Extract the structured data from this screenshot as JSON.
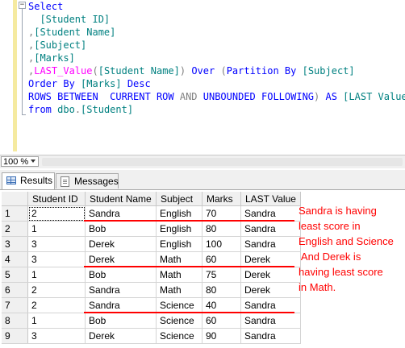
{
  "editor": {
    "collapse_glyph": "−",
    "lines": [
      [
        [
          "kw",
          "Select"
        ]
      ],
      [
        [
          "id",
          "  [Student ID]"
        ]
      ],
      [
        [
          "gr",
          ","
        ],
        [
          "id",
          "[Student Name]"
        ]
      ],
      [
        [
          "gr",
          ","
        ],
        [
          "id",
          "[Subject]"
        ]
      ],
      [
        [
          "gr",
          ","
        ],
        [
          "id",
          "[Marks]"
        ]
      ],
      [
        [
          "gr",
          ","
        ],
        [
          "fn",
          "LAST_Value"
        ],
        [
          "gr",
          "("
        ],
        [
          "id",
          "[Student Name]"
        ],
        [
          "gr",
          ") "
        ],
        [
          "kw",
          "Over "
        ],
        [
          "gr",
          "("
        ],
        [
          "kw",
          "Partition By "
        ],
        [
          "id",
          "[Subject]"
        ]
      ],
      [
        [
          "kw",
          "Order By "
        ],
        [
          "id",
          "[Marks] "
        ],
        [
          "kw",
          "Desc"
        ]
      ],
      [
        [
          "kw",
          "ROWS BETWEEN  CURRENT ROW "
        ],
        [
          "gr",
          "AND "
        ],
        [
          "kw",
          "UNBOUNDED FOLLOWING"
        ],
        [
          "gr",
          ") "
        ],
        [
          "kw",
          "AS "
        ],
        [
          "id",
          "[LAST Value]"
        ]
      ],
      [
        [
          "kw",
          "from "
        ],
        [
          "id",
          "dbo"
        ],
        [
          "gr",
          "."
        ],
        [
          "id",
          "[Student]"
        ]
      ]
    ]
  },
  "zoom": {
    "value": "100 %"
  },
  "tabs": [
    {
      "label": "Results",
      "icon": "grid-icon",
      "active": true
    },
    {
      "label": "Messages",
      "icon": "messages-icon",
      "active": false
    }
  ],
  "grid": {
    "columns": [
      "Student ID",
      "Student Name",
      "Subject",
      "Marks",
      "LAST Value"
    ],
    "rows": [
      {
        "n": "1",
        "cells": [
          "2",
          "Sandra",
          "English",
          "70",
          "Sandra"
        ]
      },
      {
        "n": "2",
        "cells": [
          "1",
          "Bob",
          "English",
          "80",
          "Sandra"
        ]
      },
      {
        "n": "3",
        "cells": [
          "3",
          "Derek",
          "English",
          "100",
          "Sandra"
        ]
      },
      {
        "n": "4",
        "cells": [
          "3",
          "Derek",
          "Math",
          "60",
          "Derek"
        ]
      },
      {
        "n": "5",
        "cells": [
          "1",
          "Bob",
          "Math",
          "75",
          "Derek"
        ]
      },
      {
        "n": "6",
        "cells": [
          "2",
          "Sandra",
          "Math",
          "80",
          "Derek"
        ]
      },
      {
        "n": "7",
        "cells": [
          "2",
          "Sandra",
          "Science",
          "40",
          "Sandra"
        ]
      },
      {
        "n": "8",
        "cells": [
          "1",
          "Bob",
          "Science",
          "60",
          "Sandra"
        ]
      },
      {
        "n": "9",
        "cells": [
          "3",
          "Derek",
          "Science",
          "90",
          "Sandra"
        ]
      }
    ]
  },
  "annotation": {
    "text": "Sandra is having\nleast score in\nEnglish and Science\n And Derek is\nhaving least score\nin Math.",
    "underlined_rows": [
      1,
      4,
      7
    ],
    "color": "#ff0000"
  }
}
